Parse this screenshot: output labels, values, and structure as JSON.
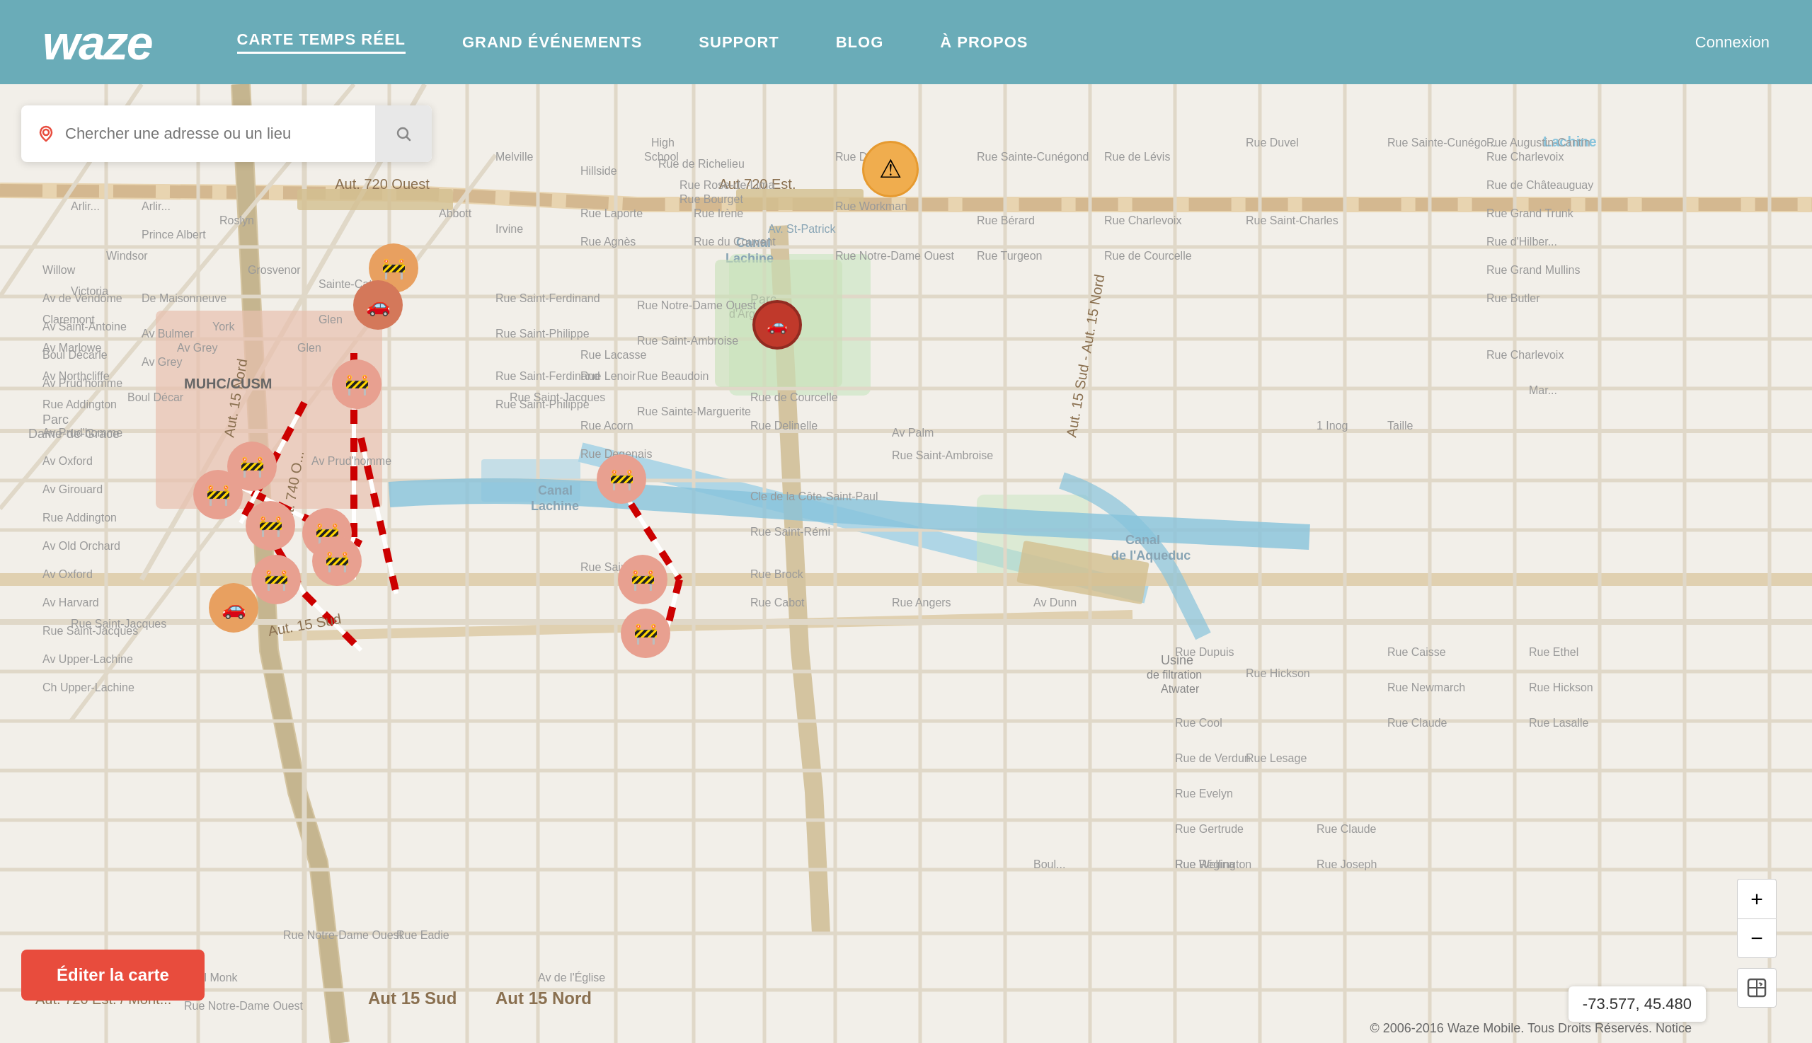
{
  "header": {
    "logo": "waze",
    "nav": [
      {
        "label": "CARTE TEMPS RÉEL",
        "active": true,
        "id": "carte"
      },
      {
        "label": "GRAND ÉVÉNEMENTS",
        "active": false,
        "id": "events"
      },
      {
        "label": "SUPPORT",
        "active": false,
        "id": "support"
      },
      {
        "label": "BLOG",
        "active": false,
        "id": "blog"
      },
      {
        "label": "À PROPOS",
        "active": false,
        "id": "apropos"
      }
    ],
    "connexion": "Connexion"
  },
  "search": {
    "placeholder": "Chercher une adresse ou un lieu"
  },
  "map": {
    "coordinates": "-73.577, 45.480"
  },
  "buttons": {
    "edit": "Éditer la carte",
    "zoom_in": "+",
    "zoom_out": "−"
  },
  "copyright": "© 2006-2016 Waze Mobile. Tous Droits Réservés. Notice"
}
